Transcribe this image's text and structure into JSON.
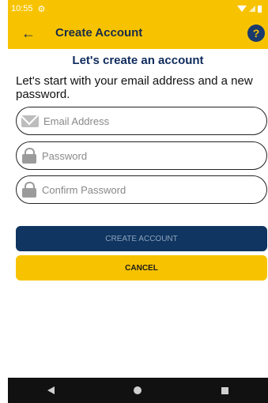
{
  "status_bar": {
    "time": "10:55",
    "settings_glyph": "⚙"
  },
  "app_bar": {
    "back_glyph": "←",
    "title": "Create Account",
    "help_glyph": "?"
  },
  "form": {
    "heading": "Let's create an account",
    "subtext": "Let's start with your email address and a new password.",
    "email_placeholder": "Email Address",
    "password_placeholder": "Password",
    "confirm_placeholder": "Confirm Password",
    "create_label": "CREATE ACCOUNT",
    "cancel_label": "CANCEL"
  },
  "colors": {
    "accent": "#f7c300",
    "primary": "#0f3560",
    "heading": "#0f2b5c"
  },
  "icons": [
    "back-arrow-icon",
    "help-icon",
    "email-icon",
    "lock-icon",
    "settings-icon",
    "wifi-icon",
    "battery-icon"
  ]
}
